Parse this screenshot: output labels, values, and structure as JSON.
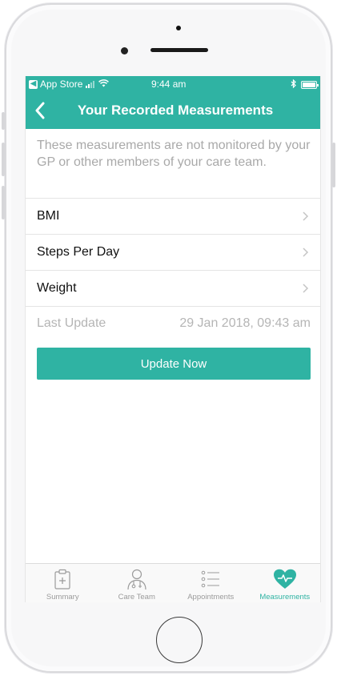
{
  "status_bar": {
    "back_app_label": "App Store",
    "time": "9:44 am"
  },
  "nav": {
    "title": "Your Recorded Measurements"
  },
  "notice": "These measurements are not monitored by your GP or other members of your care team.",
  "measurements": [
    {
      "label": "BMI"
    },
    {
      "label": "Steps Per Day"
    },
    {
      "label": "Weight"
    }
  ],
  "last_update": {
    "label": "Last Update",
    "value": "29 Jan 2018, 09:43 am"
  },
  "update_button": "Update Now",
  "tabs": [
    {
      "label": "Summary",
      "icon": "clipboard-icon",
      "active": false
    },
    {
      "label": "Care Team",
      "icon": "doctor-icon",
      "active": false
    },
    {
      "label": "Appointments",
      "icon": "list-icon",
      "active": false
    },
    {
      "label": "Measurements",
      "icon": "heart-pulse-icon",
      "active": true
    }
  ],
  "colors": {
    "accent": "#2fb3a3",
    "muted_text": "#a9a9a9",
    "tab_inactive": "#9b9b9b"
  }
}
